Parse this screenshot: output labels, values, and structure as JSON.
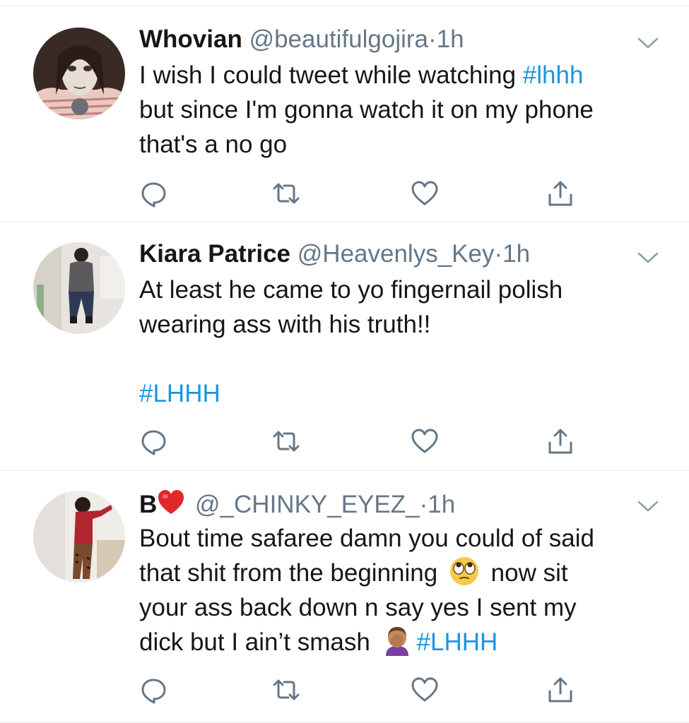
{
  "tweets": [
    {
      "name": "Whovian",
      "handle": "@beautifulgojira",
      "separator": "·",
      "time": "1h",
      "lines": [
        {
          "text": "I wish I could tweet while watching ",
          "tag": "#lhhh"
        },
        {
          "text": "but since I'm gonna watch it on my phone"
        },
        {
          "text": "that's a no go"
        }
      ],
      "actions": [
        "reply-icon",
        "retweet-icon",
        "like-icon",
        "share-icon"
      ]
    },
    {
      "name": "Kiara Patrice",
      "handle": "@Heavenlys_Key",
      "separator": "·",
      "time": "1h",
      "lines": [
        {
          "text": "At least he came to yo fingernail polish"
        },
        {
          "text": "wearing ass with his truth!!"
        }
      ],
      "hashtag_line": "#LHHH",
      "actions": [
        "reply-icon",
        "retweet-icon",
        "like-icon",
        "share-icon"
      ]
    },
    {
      "name": "B",
      "name_emoji": "red-heart-emoji",
      "handle": "@_CHINKY_EYEZ_",
      "separator": "·",
      "time": "1h",
      "lines": [
        {
          "text": "Bout time safaree damn you could of said"
        },
        {
          "text": "that shit from the beginning ",
          "emoji": "rolling-eyes-emoji",
          "after": " now sit"
        },
        {
          "text": "your ass back down n say yes I sent my"
        },
        {
          "text": "dick but I ain’t smash ",
          "emoji": "facepalm-emoji",
          "tag": "#LHHH"
        }
      ],
      "actions": [
        "reply-icon",
        "retweet-icon",
        "like-icon",
        "share-icon"
      ]
    }
  ],
  "colors": {
    "link": "#1b95e0",
    "secondary": "#657786",
    "divider": "#e6ecf0",
    "icon": "#657786"
  }
}
